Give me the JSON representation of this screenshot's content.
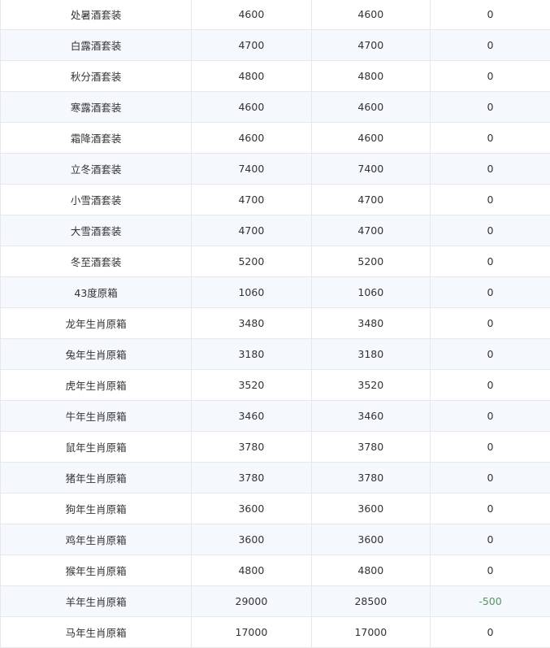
{
  "table": {
    "rows": [
      {
        "name": "处暑酒套装",
        "a": "4600",
        "b": "4600",
        "diff": "0"
      },
      {
        "name": "白露酒套装",
        "a": "4700",
        "b": "4700",
        "diff": "0"
      },
      {
        "name": "秋分酒套装",
        "a": "4800",
        "b": "4800",
        "diff": "0"
      },
      {
        "name": "寒露酒套装",
        "a": "4600",
        "b": "4600",
        "diff": "0"
      },
      {
        "name": "霜降酒套装",
        "a": "4600",
        "b": "4600",
        "diff": "0"
      },
      {
        "name": "立冬酒套装",
        "a": "7400",
        "b": "7400",
        "diff": "0"
      },
      {
        "name": "小雪酒套装",
        "a": "4700",
        "b": "4700",
        "diff": "0"
      },
      {
        "name": "大雪酒套装",
        "a": "4700",
        "b": "4700",
        "diff": "0"
      },
      {
        "name": "冬至酒套装",
        "a": "5200",
        "b": "5200",
        "diff": "0"
      },
      {
        "name": "43度原箱",
        "a": "1060",
        "b": "1060",
        "diff": "0"
      },
      {
        "name": "龙年生肖原箱",
        "a": "3480",
        "b": "3480",
        "diff": "0"
      },
      {
        "name": "兔年生肖原箱",
        "a": "3180",
        "b": "3180",
        "diff": "0"
      },
      {
        "name": "虎年生肖原箱",
        "a": "3520",
        "b": "3520",
        "diff": "0"
      },
      {
        "name": "牛年生肖原箱",
        "a": "3460",
        "b": "3460",
        "diff": "0"
      },
      {
        "name": "鼠年生肖原箱",
        "a": "3780",
        "b": "3780",
        "diff": "0"
      },
      {
        "name": "猪年生肖原箱",
        "a": "3780",
        "b": "3780",
        "diff": "0"
      },
      {
        "name": "狗年生肖原箱",
        "a": "3600",
        "b": "3600",
        "diff": "0"
      },
      {
        "name": "鸡年生肖原箱",
        "a": "3600",
        "b": "3600",
        "diff": "0"
      },
      {
        "name": "猴年生肖原箱",
        "a": "4800",
        "b": "4800",
        "diff": "0"
      },
      {
        "name": "羊年生肖原箱",
        "a": "29000",
        "b": "28500",
        "diff": "-500"
      },
      {
        "name": "马年生肖原箱",
        "a": "17000",
        "b": "17000",
        "diff": "0"
      }
    ],
    "colors": {
      "negative": "#4c9a5c",
      "stripe": "#f5f8fd",
      "border": "#e6e8ec"
    }
  }
}
